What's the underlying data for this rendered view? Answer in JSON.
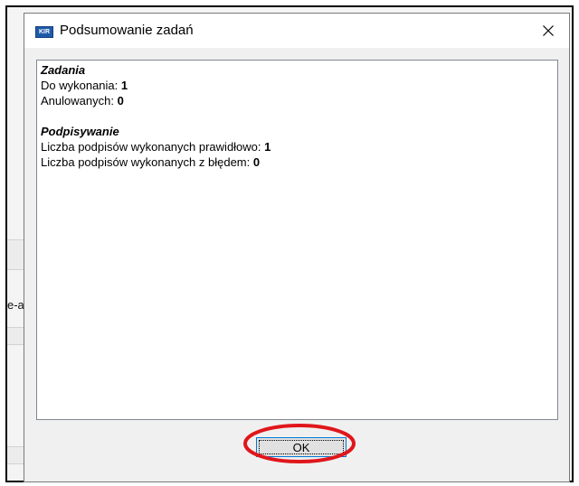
{
  "dialog": {
    "title": "Podsumowanie zadań",
    "app_icon": "app-logo-icon",
    "close_icon": "close-icon",
    "ok_label": "OK"
  },
  "summary": {
    "tasks_header": "Zadania",
    "to_do_label": "Do wykonania: ",
    "to_do_value": "1",
    "cancelled_label": "Anulowanych: ",
    "cancelled_value": "0",
    "signing_header": "Podpisywanie",
    "signed_ok_label": "Liczba podpisów wykonanych prawidłowo: ",
    "signed_ok_value": "1",
    "signed_err_label": "Liczba podpisów wykonanych z błędem: ",
    "signed_err_value": "0"
  },
  "background": {
    "fragment_text": "e-a"
  },
  "colors": {
    "highlight": "#e0161b",
    "focus_border": "#0078d7"
  }
}
